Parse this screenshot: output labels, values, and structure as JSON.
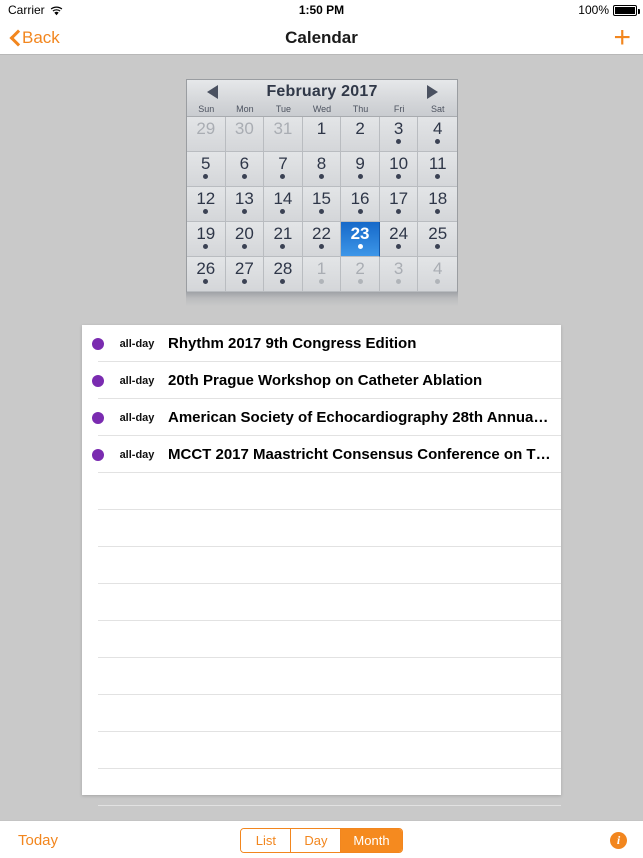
{
  "status_bar": {
    "carrier": "Carrier",
    "wifi_icon": "wifi-icon",
    "time": "1:50 PM",
    "battery_percent": "100%",
    "battery_icon": "battery-icon"
  },
  "nav_bar": {
    "back_label": "Back",
    "back_icon": "chevron-left-icon",
    "title": "Calendar",
    "add_icon": "plus-icon",
    "accent_color": "#f2861e"
  },
  "calendar": {
    "prev_icon": "triangle-left-icon",
    "next_icon": "triangle-right-icon",
    "month_label": "February 2017",
    "weekdays": [
      "Sun",
      "Mon",
      "Tue",
      "Wed",
      "Thu",
      "Fri",
      "Sat"
    ],
    "selected_day": 23,
    "selected_color": "#1669c9",
    "days": [
      {
        "n": "29",
        "other": true,
        "dot": false,
        "sel": false
      },
      {
        "n": "30",
        "other": true,
        "dot": false,
        "sel": false
      },
      {
        "n": "31",
        "other": true,
        "dot": false,
        "sel": false
      },
      {
        "n": "1",
        "other": false,
        "dot": false,
        "sel": false
      },
      {
        "n": "2",
        "other": false,
        "dot": false,
        "sel": false
      },
      {
        "n": "3",
        "other": false,
        "dot": true,
        "sel": false
      },
      {
        "n": "4",
        "other": false,
        "dot": true,
        "sel": false
      },
      {
        "n": "5",
        "other": false,
        "dot": true,
        "sel": false
      },
      {
        "n": "6",
        "other": false,
        "dot": true,
        "sel": false
      },
      {
        "n": "7",
        "other": false,
        "dot": true,
        "sel": false
      },
      {
        "n": "8",
        "other": false,
        "dot": true,
        "sel": false
      },
      {
        "n": "9",
        "other": false,
        "dot": true,
        "sel": false
      },
      {
        "n": "10",
        "other": false,
        "dot": true,
        "sel": false
      },
      {
        "n": "11",
        "other": false,
        "dot": true,
        "sel": false
      },
      {
        "n": "12",
        "other": false,
        "dot": true,
        "sel": false
      },
      {
        "n": "13",
        "other": false,
        "dot": true,
        "sel": false
      },
      {
        "n": "14",
        "other": false,
        "dot": true,
        "sel": false
      },
      {
        "n": "15",
        "other": false,
        "dot": true,
        "sel": false
      },
      {
        "n": "16",
        "other": false,
        "dot": true,
        "sel": false
      },
      {
        "n": "17",
        "other": false,
        "dot": true,
        "sel": false
      },
      {
        "n": "18",
        "other": false,
        "dot": true,
        "sel": false
      },
      {
        "n": "19",
        "other": false,
        "dot": true,
        "sel": false
      },
      {
        "n": "20",
        "other": false,
        "dot": true,
        "sel": false
      },
      {
        "n": "21",
        "other": false,
        "dot": true,
        "sel": false
      },
      {
        "n": "22",
        "other": false,
        "dot": true,
        "sel": false
      },
      {
        "n": "23",
        "other": false,
        "dot": true,
        "sel": true
      },
      {
        "n": "24",
        "other": false,
        "dot": true,
        "sel": false
      },
      {
        "n": "25",
        "other": false,
        "dot": true,
        "sel": false
      },
      {
        "n": "26",
        "other": false,
        "dot": true,
        "sel": false
      },
      {
        "n": "27",
        "other": false,
        "dot": true,
        "sel": false
      },
      {
        "n": "28",
        "other": false,
        "dot": true,
        "sel": false
      },
      {
        "n": "1",
        "other": true,
        "dot": true,
        "sel": false
      },
      {
        "n": "2",
        "other": true,
        "dot": true,
        "sel": false
      },
      {
        "n": "3",
        "other": true,
        "dot": true,
        "sel": false
      },
      {
        "n": "4",
        "other": true,
        "dot": true,
        "sel": false
      }
    ]
  },
  "event_list": {
    "dot_color": "#7a2bb0",
    "events": [
      {
        "time": "all-day",
        "title": "Rhythm 2017 9th Congress Edition"
      },
      {
        "time": "all-day",
        "title": "20th Prague Workshop on Catheter Ablation"
      },
      {
        "time": "all-day",
        "title": "American Society of Echocardiography 28th Annual…"
      },
      {
        "time": "all-day",
        "title": "MCCT 2017 Maastricht Consensus Conference on T…"
      }
    ],
    "empty_row_count": 9
  },
  "toolbar": {
    "today_label": "Today",
    "segments": [
      "List",
      "Day",
      "Month"
    ],
    "selected_segment": "Month",
    "info_icon": "info-circle-icon",
    "info_glyph": "i"
  }
}
